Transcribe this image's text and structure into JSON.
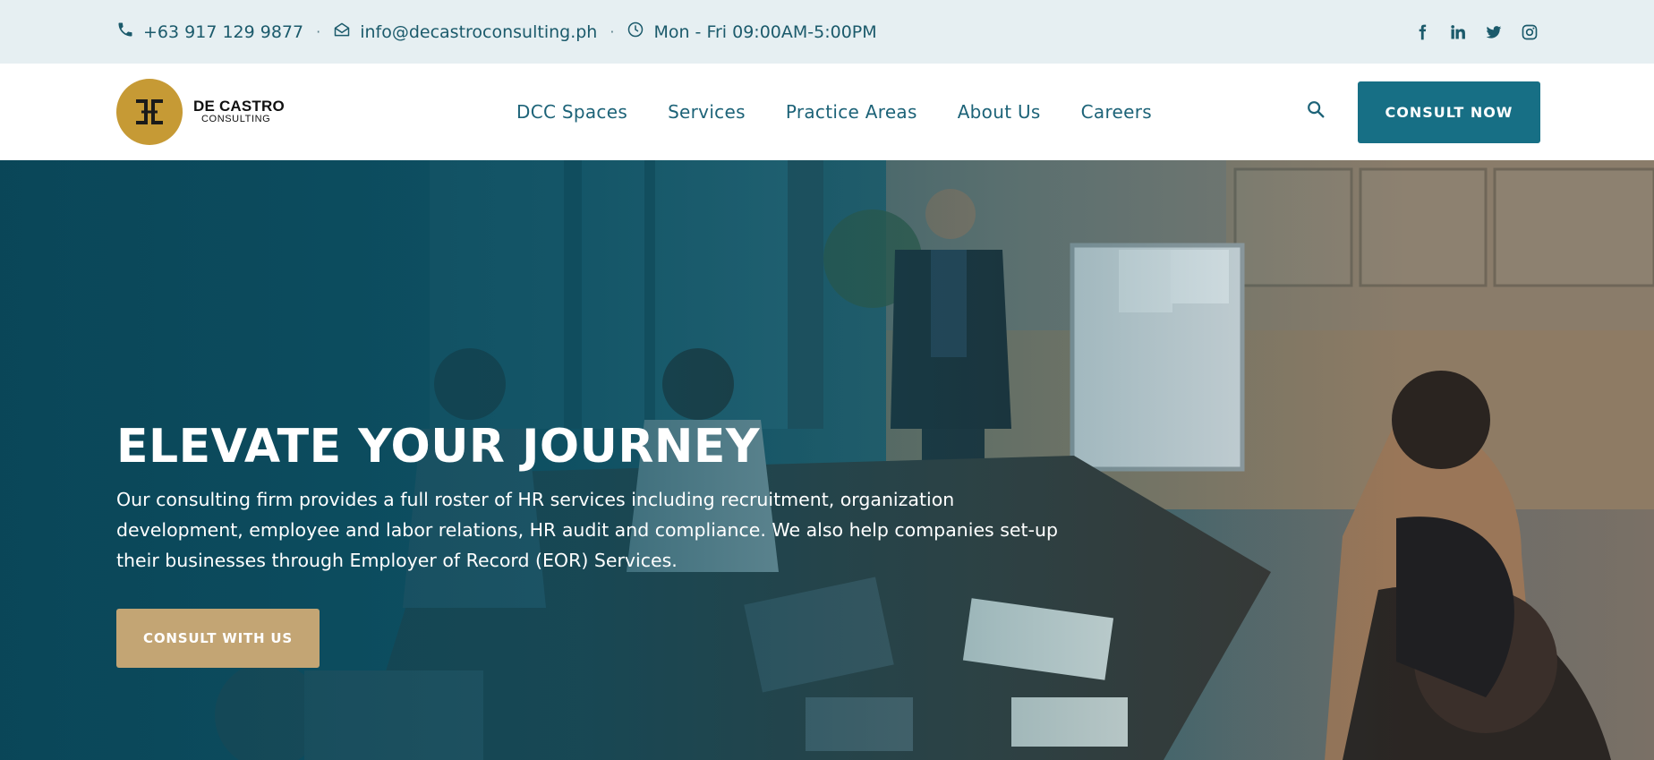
{
  "topbar": {
    "phone": "+63 917 129 9877",
    "email": "info@decastroconsulting.ph",
    "hours": "Mon - Fri 09:00AM-5:00PM",
    "separator": "·",
    "socials": [
      "facebook-icon",
      "linkedin-icon",
      "twitter-icon",
      "instagram-icon"
    ]
  },
  "logo": {
    "line1": "DE CASTRO",
    "line2": "CONSULTING"
  },
  "nav": {
    "items": [
      {
        "label": "DCC Spaces"
      },
      {
        "label": "Services"
      },
      {
        "label": "Practice Areas"
      },
      {
        "label": "About Us"
      },
      {
        "label": "Careers"
      }
    ],
    "cta_label": "CONSULT NOW"
  },
  "hero": {
    "title": "ELEVATE YOUR JOURNEY",
    "description": "Our consulting firm provides a full roster of HR services including recruitment, organization development, employee and labor relations, HR audit and compliance. We also help companies set-up their businesses through Employer of Record (EOR) Services.",
    "cta_label": "CONSULT WITH US"
  },
  "colors": {
    "topbar_bg": "#e6eff2",
    "brand_teal": "#176f85",
    "logo_gold": "#c69a35",
    "hero_button": "#c3a574"
  }
}
